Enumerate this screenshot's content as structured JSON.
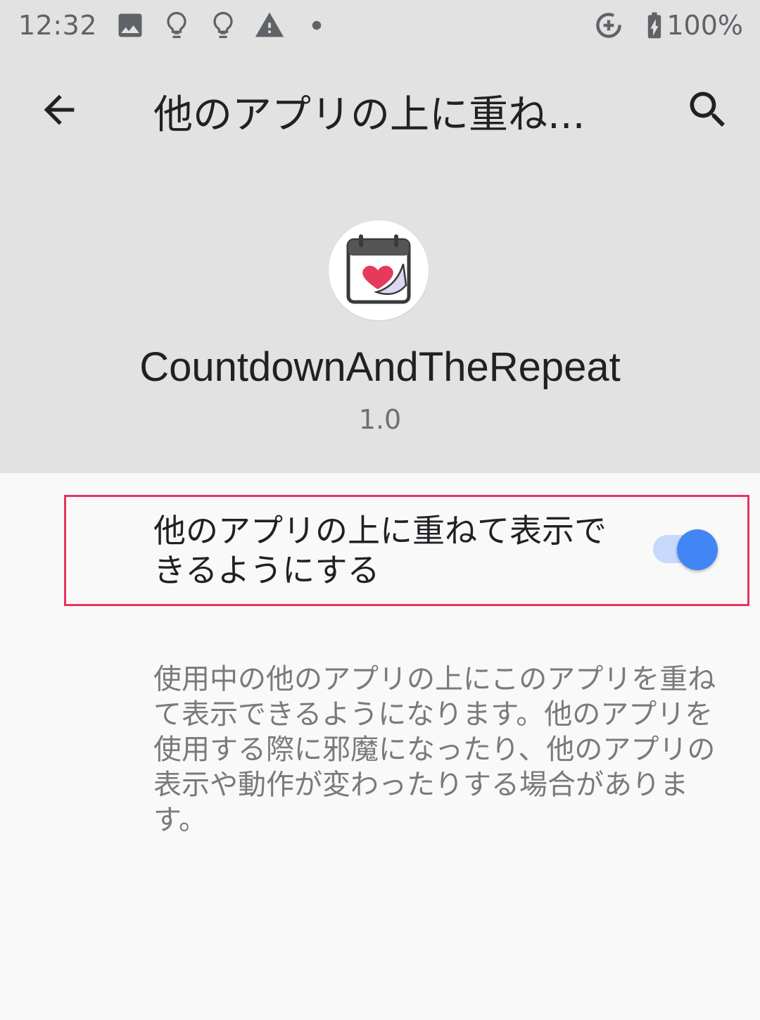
{
  "status_bar": {
    "time": "12:32",
    "icons": [
      "image-icon",
      "lightbulb-icon",
      "lightbulb-icon",
      "warning-icon",
      "dot-icon",
      "data-saver-icon",
      "battery-charging-icon"
    ],
    "battery": "100%"
  },
  "toolbar": {
    "title": "他のアプリの上に重ね...",
    "back_icon": "arrow-back-icon",
    "search_icon": "search-icon"
  },
  "app": {
    "name": "CountdownAndTheRepeat",
    "version": "1.0",
    "icon": "calendar-heart-icon"
  },
  "setting": {
    "label": "他のアプリの上に重ねて表示できるようにする",
    "enabled": true,
    "description": "使用中の他のアプリの上にこのアプリを重ねて表示できるようになります。他のアプリを使用する際に邪魔になったり、他のアプリの表示や動作が変わったりする場合があります。"
  },
  "colors": {
    "header_bg": "#e2e2e2",
    "body_bg": "#f9f9f9",
    "accent": "#4285f4",
    "highlight": "#e8345e"
  }
}
